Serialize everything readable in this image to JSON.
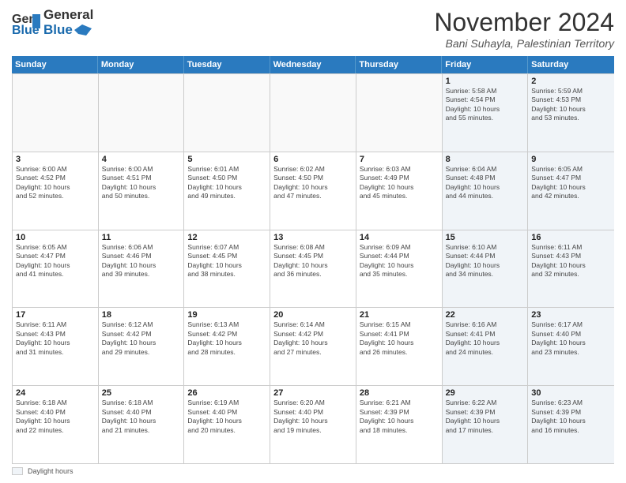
{
  "logo": {
    "line1": "General",
    "line2": "Blue"
  },
  "title": "November 2024",
  "location": "Bani Suhayla, Palestinian Territory",
  "days_header": [
    "Sunday",
    "Monday",
    "Tuesday",
    "Wednesday",
    "Thursday",
    "Friday",
    "Saturday"
  ],
  "footer": {
    "legend_label": "Daylight hours"
  },
  "weeks": [
    [
      {
        "day": "",
        "info": ""
      },
      {
        "day": "",
        "info": ""
      },
      {
        "day": "",
        "info": ""
      },
      {
        "day": "",
        "info": ""
      },
      {
        "day": "",
        "info": ""
      },
      {
        "day": "1",
        "info": "Sunrise: 5:58 AM\nSunset: 4:54 PM\nDaylight: 10 hours\nand 55 minutes."
      },
      {
        "day": "2",
        "info": "Sunrise: 5:59 AM\nSunset: 4:53 PM\nDaylight: 10 hours\nand 53 minutes."
      }
    ],
    [
      {
        "day": "3",
        "info": "Sunrise: 6:00 AM\nSunset: 4:52 PM\nDaylight: 10 hours\nand 52 minutes."
      },
      {
        "day": "4",
        "info": "Sunrise: 6:00 AM\nSunset: 4:51 PM\nDaylight: 10 hours\nand 50 minutes."
      },
      {
        "day": "5",
        "info": "Sunrise: 6:01 AM\nSunset: 4:50 PM\nDaylight: 10 hours\nand 49 minutes."
      },
      {
        "day": "6",
        "info": "Sunrise: 6:02 AM\nSunset: 4:50 PM\nDaylight: 10 hours\nand 47 minutes."
      },
      {
        "day": "7",
        "info": "Sunrise: 6:03 AM\nSunset: 4:49 PM\nDaylight: 10 hours\nand 45 minutes."
      },
      {
        "day": "8",
        "info": "Sunrise: 6:04 AM\nSunset: 4:48 PM\nDaylight: 10 hours\nand 44 minutes."
      },
      {
        "day": "9",
        "info": "Sunrise: 6:05 AM\nSunset: 4:47 PM\nDaylight: 10 hours\nand 42 minutes."
      }
    ],
    [
      {
        "day": "10",
        "info": "Sunrise: 6:05 AM\nSunset: 4:47 PM\nDaylight: 10 hours\nand 41 minutes."
      },
      {
        "day": "11",
        "info": "Sunrise: 6:06 AM\nSunset: 4:46 PM\nDaylight: 10 hours\nand 39 minutes."
      },
      {
        "day": "12",
        "info": "Sunrise: 6:07 AM\nSunset: 4:45 PM\nDaylight: 10 hours\nand 38 minutes."
      },
      {
        "day": "13",
        "info": "Sunrise: 6:08 AM\nSunset: 4:45 PM\nDaylight: 10 hours\nand 36 minutes."
      },
      {
        "day": "14",
        "info": "Sunrise: 6:09 AM\nSunset: 4:44 PM\nDaylight: 10 hours\nand 35 minutes."
      },
      {
        "day": "15",
        "info": "Sunrise: 6:10 AM\nSunset: 4:44 PM\nDaylight: 10 hours\nand 34 minutes."
      },
      {
        "day": "16",
        "info": "Sunrise: 6:11 AM\nSunset: 4:43 PM\nDaylight: 10 hours\nand 32 minutes."
      }
    ],
    [
      {
        "day": "17",
        "info": "Sunrise: 6:11 AM\nSunset: 4:43 PM\nDaylight: 10 hours\nand 31 minutes."
      },
      {
        "day": "18",
        "info": "Sunrise: 6:12 AM\nSunset: 4:42 PM\nDaylight: 10 hours\nand 29 minutes."
      },
      {
        "day": "19",
        "info": "Sunrise: 6:13 AM\nSunset: 4:42 PM\nDaylight: 10 hours\nand 28 minutes."
      },
      {
        "day": "20",
        "info": "Sunrise: 6:14 AM\nSunset: 4:42 PM\nDaylight: 10 hours\nand 27 minutes."
      },
      {
        "day": "21",
        "info": "Sunrise: 6:15 AM\nSunset: 4:41 PM\nDaylight: 10 hours\nand 26 minutes."
      },
      {
        "day": "22",
        "info": "Sunrise: 6:16 AM\nSunset: 4:41 PM\nDaylight: 10 hours\nand 24 minutes."
      },
      {
        "day": "23",
        "info": "Sunrise: 6:17 AM\nSunset: 4:40 PM\nDaylight: 10 hours\nand 23 minutes."
      }
    ],
    [
      {
        "day": "24",
        "info": "Sunrise: 6:18 AM\nSunset: 4:40 PM\nDaylight: 10 hours\nand 22 minutes."
      },
      {
        "day": "25",
        "info": "Sunrise: 6:18 AM\nSunset: 4:40 PM\nDaylight: 10 hours\nand 21 minutes."
      },
      {
        "day": "26",
        "info": "Sunrise: 6:19 AM\nSunset: 4:40 PM\nDaylight: 10 hours\nand 20 minutes."
      },
      {
        "day": "27",
        "info": "Sunrise: 6:20 AM\nSunset: 4:40 PM\nDaylight: 10 hours\nand 19 minutes."
      },
      {
        "day": "28",
        "info": "Sunrise: 6:21 AM\nSunset: 4:39 PM\nDaylight: 10 hours\nand 18 minutes."
      },
      {
        "day": "29",
        "info": "Sunrise: 6:22 AM\nSunset: 4:39 PM\nDaylight: 10 hours\nand 17 minutes."
      },
      {
        "day": "30",
        "info": "Sunrise: 6:23 AM\nSunset: 4:39 PM\nDaylight: 10 hours\nand 16 minutes."
      }
    ]
  ]
}
